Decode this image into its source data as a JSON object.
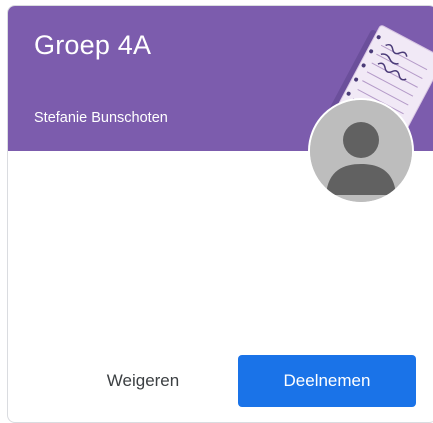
{
  "card": {
    "title": "Groep 4A",
    "teacher": "Stefanie Bunschoten",
    "header_color": "#7c5cad",
    "avatar_icon": "person-placeholder-icon",
    "illustration": "notebook-illustration"
  },
  "actions": {
    "decline_label": "Weigeren",
    "join_label": "Deelnemen",
    "join_color": "#1a73e8"
  }
}
